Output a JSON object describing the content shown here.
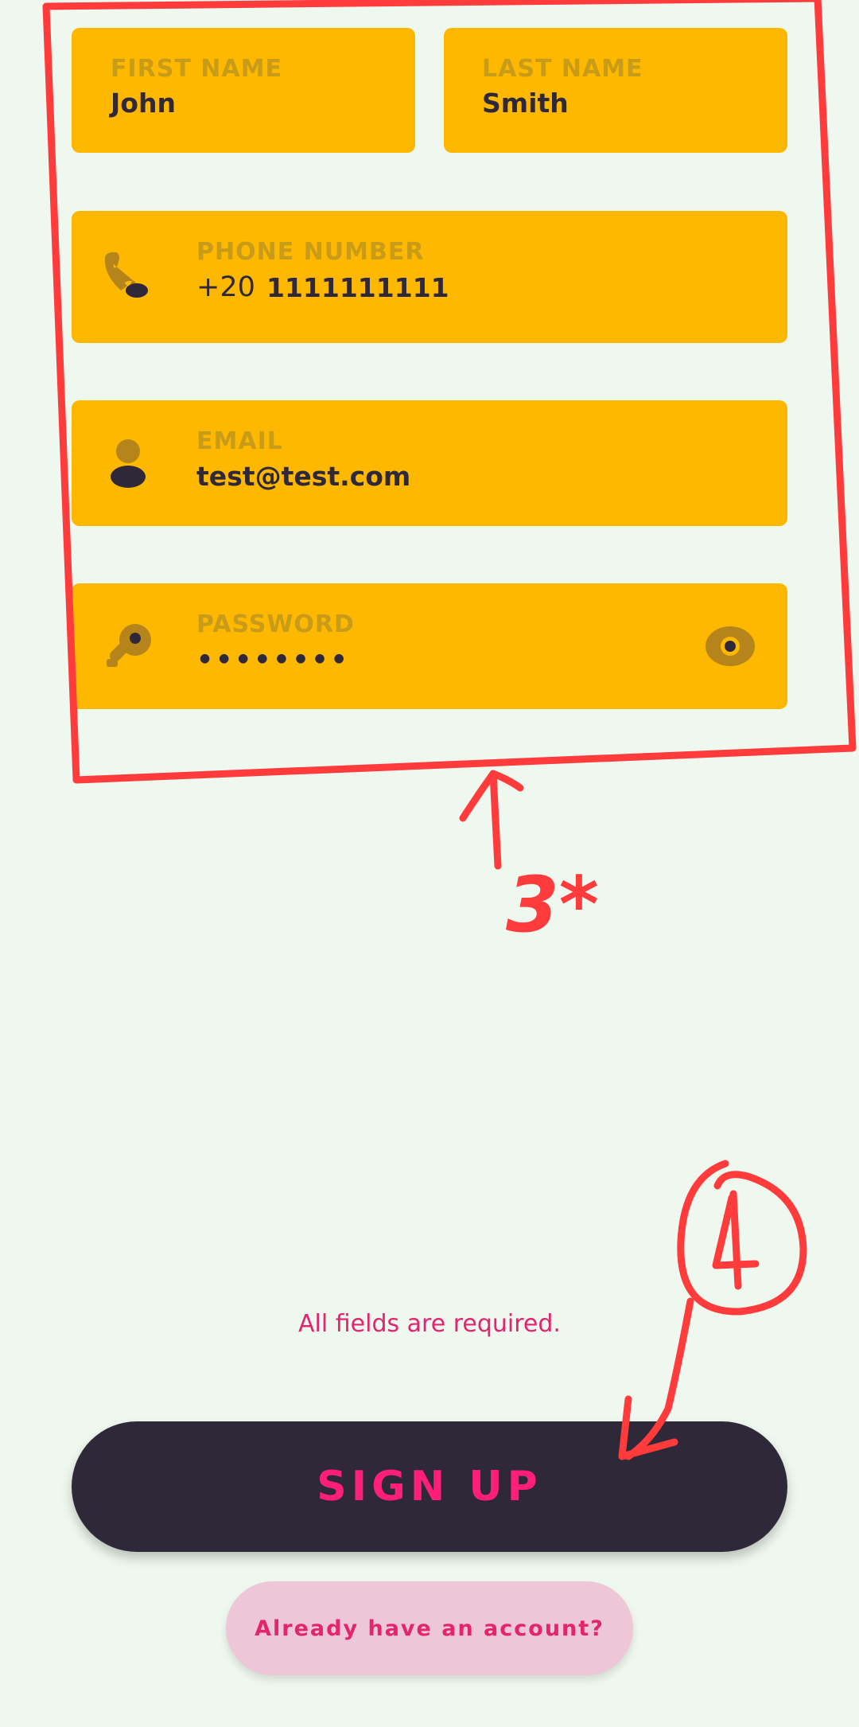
{
  "form": {
    "first_name": {
      "label": "FIRST NAME",
      "value": "John"
    },
    "last_name": {
      "label": "LAST NAME",
      "value": "Smith"
    },
    "phone": {
      "label": "PHONE NUMBER",
      "country_code": "+20",
      "value": "1111111111"
    },
    "email": {
      "label": "EMAIL",
      "value": "test@test.com"
    },
    "password": {
      "label": "PASSWORD",
      "value": "••••••••"
    }
  },
  "helper_text": "All fields are required.",
  "buttons": {
    "sign_up": "SIGN UP",
    "already_account": "Already have an account?"
  },
  "annotations": {
    "label_3": "3*",
    "label_4": "4"
  },
  "icons": {
    "phone": "phone-icon",
    "email": "person-icon",
    "password": "key-icon",
    "toggle": "eye-icon"
  },
  "colors": {
    "field_bg": "#ffb800",
    "label": "#c89b18",
    "value": "#2e2838",
    "accent": "#e3246f",
    "button_bg": "#2e2838",
    "button_text": "#ff1f78",
    "annotation": "#ff3b3b"
  }
}
